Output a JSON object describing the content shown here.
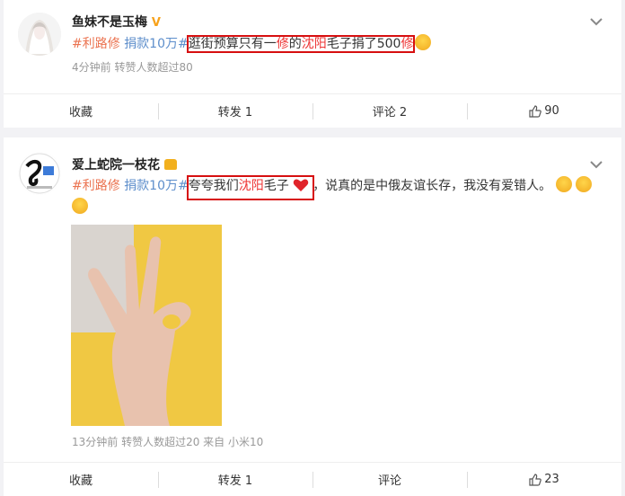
{
  "posts": [
    {
      "author": "鱼妹不是玉梅",
      "verified": "V",
      "tag1": "#利路修",
      "tag2": "捐款10万#",
      "text_a": "逛街预算只有一",
      "text_hl1": "修",
      "text_b": "的",
      "text_hl2": "沈阳",
      "text_c": "毛子捐了500",
      "text_hl3": "修",
      "meta": "4分钟前  转赞人数超过80",
      "actions": {
        "collect": "收藏",
        "repost": "转发 1",
        "comment": "评论 2",
        "like": "90"
      }
    },
    {
      "author": "爱上蛇院一枝花",
      "tag1": "#利路修",
      "tag2": "捐款10万#",
      "text_a": "夸夸我们",
      "text_hl1": "沈阳",
      "text_b": "毛子",
      "text_c": "，说真的是中俄友谊长存，我没有爱错人。",
      "meta": "13分钟前  转赞人数超过20  来自 小米10",
      "actions": {
        "collect": "收藏",
        "repost": "转发 1",
        "comment": "评论",
        "like": "23"
      }
    }
  ],
  "colors": {
    "tag": "#eb7350",
    "tag_blue": "#5d8ecb",
    "highlight_box": "#d70f10",
    "accent_red": "#e33"
  }
}
